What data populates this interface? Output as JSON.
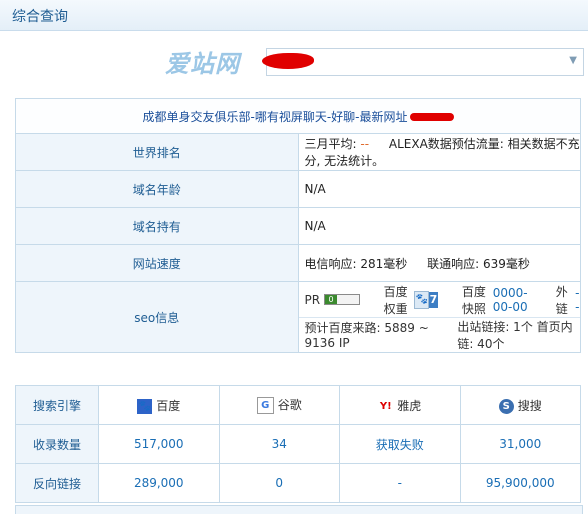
{
  "header": {
    "title": "综合查询"
  },
  "logo": {
    "text": "爱站网"
  },
  "domain_select": {
    "value": ""
  },
  "site": {
    "title": "成都单身交友俱乐部-哪有视屏聊天-好聊-最新网址"
  },
  "rows": {
    "rank": {
      "label": "世界排名",
      "avg_label": "三月平均:",
      "avg_value": "--",
      "alexa_text": "ALEXA数据预估流量: 相关数据不充分, 无法统计。"
    },
    "age": {
      "label": "域名年龄",
      "value": "N/A"
    },
    "owner": {
      "label": "域名持有",
      "value": "N/A"
    },
    "speed": {
      "label": "网站速度",
      "telecom": "电信响应: 281毫秒",
      "unicom": "联通响应: 639毫秒"
    },
    "seo": {
      "label": "seo信息",
      "pr_label": "PR",
      "pr_value": "0",
      "baidu_weight_label": "百度权重",
      "baidu_weight_value": "7",
      "snapshot_label": "百度快照",
      "snapshot_value": "0000-00-00",
      "outlink_label": "外链",
      "outlink_value": "--",
      "traffic": "预计百度来路: 5889 ~ 9136 IP",
      "links": "出站链接: 1个 首页内链: 40个"
    }
  },
  "engines": {
    "header_label": "搜索引擎",
    "names": [
      "百度",
      "谷歌",
      "雅虎",
      "搜搜"
    ],
    "icons": [
      "baidu-icon",
      "google-icon",
      "yahoo-icon",
      "soso-icon"
    ],
    "indexed_label": "收录数量",
    "indexed": [
      "517,000",
      "34",
      "获取失败",
      "31,000"
    ],
    "backlinks_label": "反向链接",
    "backlinks": [
      "289,000",
      "0",
      "-",
      "95,900,000"
    ]
  },
  "colors": {
    "accent": "#1f5d93",
    "link": "#1a6eb5",
    "border": "#c6dae9",
    "redaction": "#e00000"
  }
}
